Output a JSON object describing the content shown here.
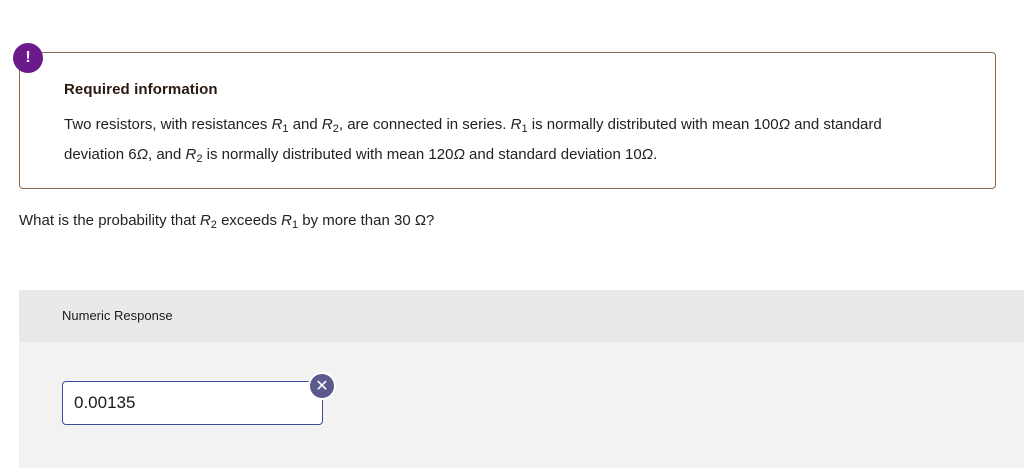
{
  "alert": {
    "icon": "exclamation-icon",
    "symbol": "!",
    "color": "#6b1a8c"
  },
  "info": {
    "title": "Required information",
    "line1": {
      "p1": "Two resistors, with resistances ",
      "r1": "R",
      "r1sub": "1",
      "p2": " and ",
      "r2": "R",
      "r2sub": "2",
      "p3": ", are connected in series. ",
      "r1b": "R",
      "r1bsub": "1",
      "p4": " is normally distributed with mean 100",
      "omega1": "Ω",
      "p5": " and standard"
    },
    "line2": {
      "p1": "deviation 6",
      "omega1": "Ω",
      "p2": ", and ",
      "r2": "R",
      "r2sub": "2",
      "p3": " is normally distributed with mean 120",
      "omega2": "Ω",
      "p4": " and standard deviation 10",
      "omega3": "Ω",
      "p5": "."
    }
  },
  "question": {
    "p1": "What is the probability that ",
    "r2": "R",
    "r2sub": "2",
    "p2": " exceeds ",
    "r1": "R",
    "r1sub": "1",
    "p3": " by more than 30 Ω?"
  },
  "response": {
    "label": "Numeric Response",
    "value": "0.00135",
    "status_icon": "close-icon",
    "status_symbol": "✕",
    "status_color": "#5a5a8c"
  }
}
